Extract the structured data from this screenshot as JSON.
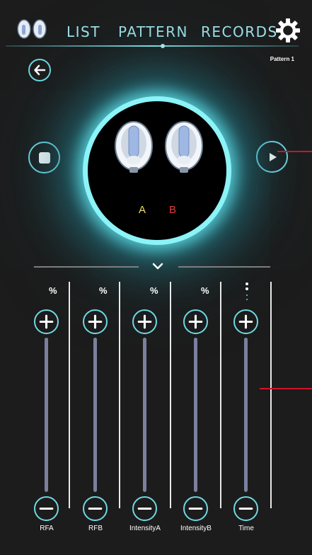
{
  "nav": {
    "tabs": [
      "LIST",
      "PATTERN",
      "RECORDS"
    ],
    "active_tab": "PATTERN"
  },
  "header": {
    "pattern_label": "Pattern 1"
  },
  "device": {
    "label_a": "A",
    "label_b": "B"
  },
  "colors": {
    "accent": "#6fd8e4",
    "label_a": "#f1df6a",
    "label_b": "#e23b3b",
    "marker": "#d0142a",
    "track": "#7b809f"
  },
  "icons": [
    "earbuds-logo-icon",
    "gear-icon",
    "back-arrow-icon",
    "stop-icon",
    "play-icon",
    "chevron-down-icon",
    "plus-icon",
    "minus-icon"
  ],
  "sliders": [
    {
      "label": "RFA",
      "unit": "%"
    },
    {
      "label": "RFB",
      "unit": "%"
    },
    {
      "label": "IntensityA",
      "unit": "%"
    },
    {
      "label": "IntensityB",
      "unit": "%"
    },
    {
      "label": "Time",
      "unit": ""
    }
  ]
}
